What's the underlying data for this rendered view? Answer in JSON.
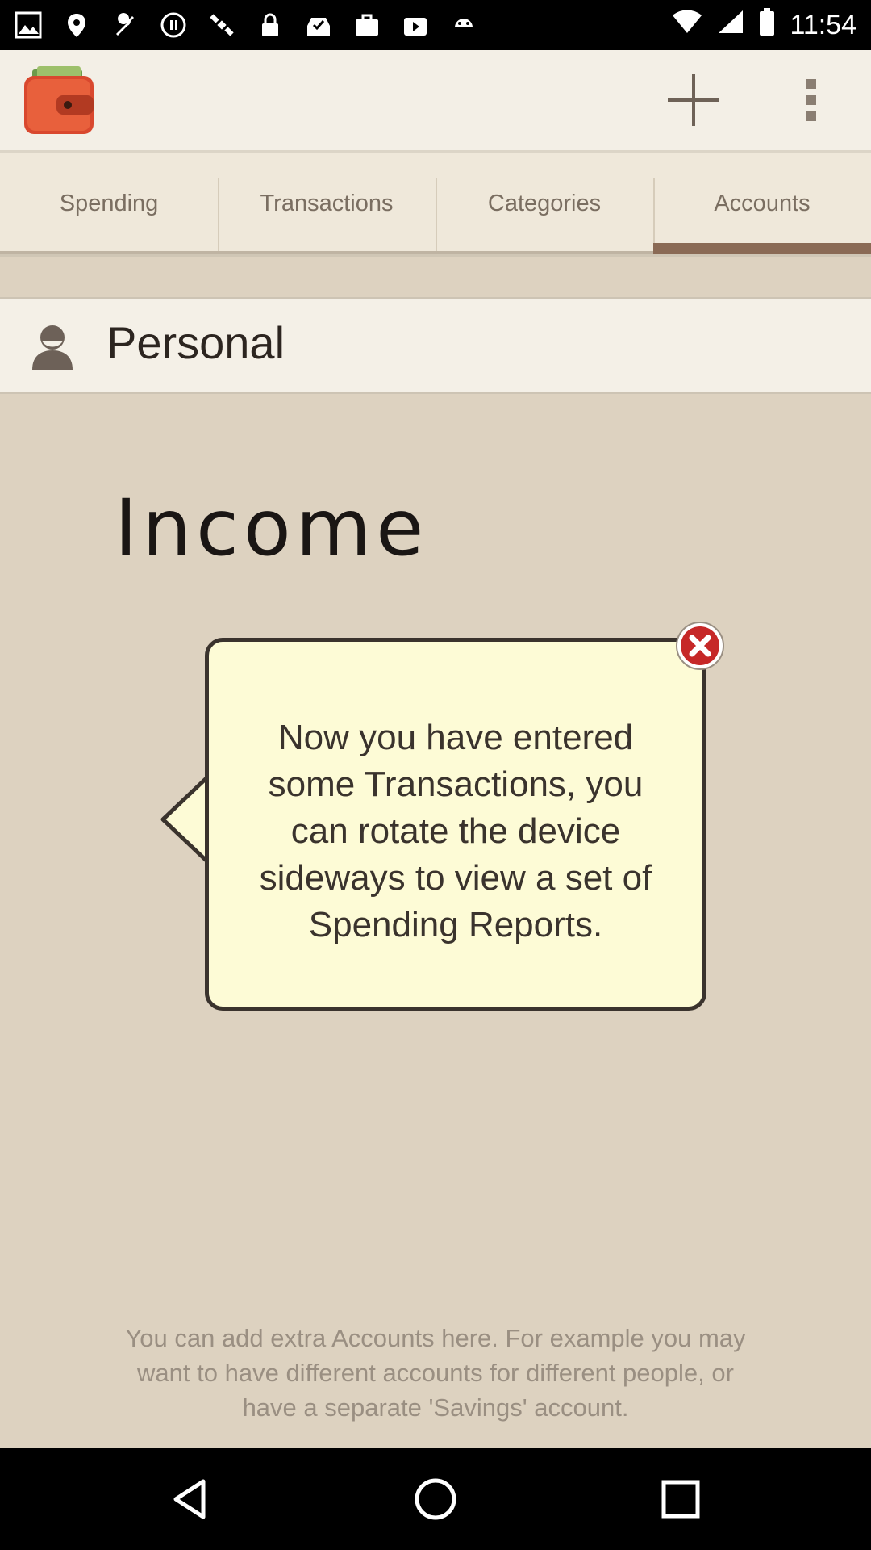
{
  "status_bar": {
    "time": "11:54",
    "icons": [
      "photo-icon",
      "fake-gps-icon",
      "wrench-icon",
      "stop-icon",
      "satellite-icon",
      "lock-icon",
      "inbox-check-icon",
      "briefcase-icon",
      "play-store-icon",
      "android-icon",
      "wifi-icon",
      "signal-icon",
      "battery-icon"
    ]
  },
  "app_bar": {
    "logo_icon": "wallet-icon",
    "add_icon": "plus-icon",
    "menu_icon": "overflow-menu-icon"
  },
  "tabs": [
    {
      "label": "Spending",
      "active": false
    },
    {
      "label": "Transactions",
      "active": false
    },
    {
      "label": "Categories",
      "active": false
    },
    {
      "label": "Accounts",
      "active": true
    }
  ],
  "account": {
    "icon": "person-icon",
    "name": "Personal"
  },
  "section": {
    "heading": "Income"
  },
  "tooltip": {
    "lines": [
      "Now you have entered",
      "some Transactions, you",
      "can rotate the device",
      "sideways to view a set of",
      "Spending Reports."
    ],
    "close_icon": "close-icon"
  },
  "footer": {
    "lines": [
      "You can add extra Accounts here. For example you may",
      "want to have different accounts for different people, or",
      "have a separate 'Savings' account."
    ]
  },
  "colors": {
    "tab_active_indicator": "#8a6a55",
    "close_red": "#c62828",
    "bubble_fill": "#fdfbd6"
  }
}
